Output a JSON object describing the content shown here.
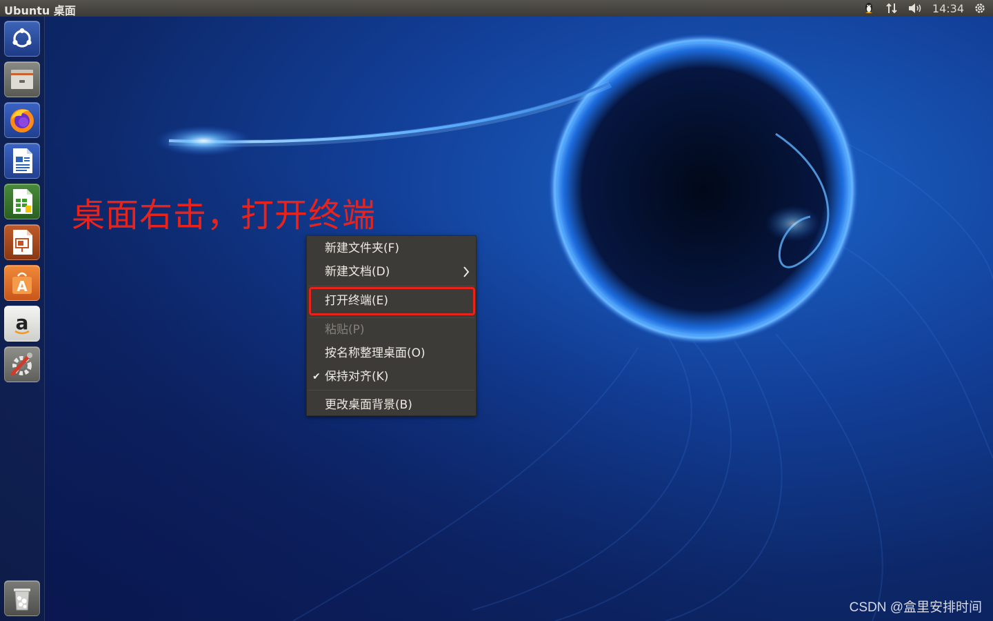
{
  "top_panel": {
    "title": "Ubuntu 桌面",
    "clock": "14:34"
  },
  "launcher": {
    "items": [
      "ubuntu-dash-icon",
      "files-icon",
      "firefox-icon",
      "libreoffice-writer-icon",
      "libreoffice-calc-icon",
      "libreoffice-impress-icon",
      "software-center-icon",
      "amazon-icon",
      "system-settings-icon"
    ],
    "trash": "trash-icon"
  },
  "annotation": {
    "text": "桌面右击，打开终端",
    "color": "#e8231c"
  },
  "context_menu": {
    "items": [
      {
        "label": "新建文件夹(F)"
      },
      {
        "label": "新建文档(D)",
        "submenu": true
      },
      {
        "label": "打开终端(E)",
        "highlighted": true
      },
      {
        "label": "粘贴(P)",
        "disabled": true
      },
      {
        "label": "按名称整理桌面(O)"
      },
      {
        "label": "保持对齐(K)",
        "checked": true
      },
      {
        "label": "更改桌面背景(B)"
      }
    ]
  },
  "watermark": "CSDN @盒里安排时间",
  "colors": {
    "panel": "#3c3b37",
    "menu_bg": "#3c3b37",
    "highlight": "#e8231c",
    "wallpaper_blue": "#123f98"
  }
}
